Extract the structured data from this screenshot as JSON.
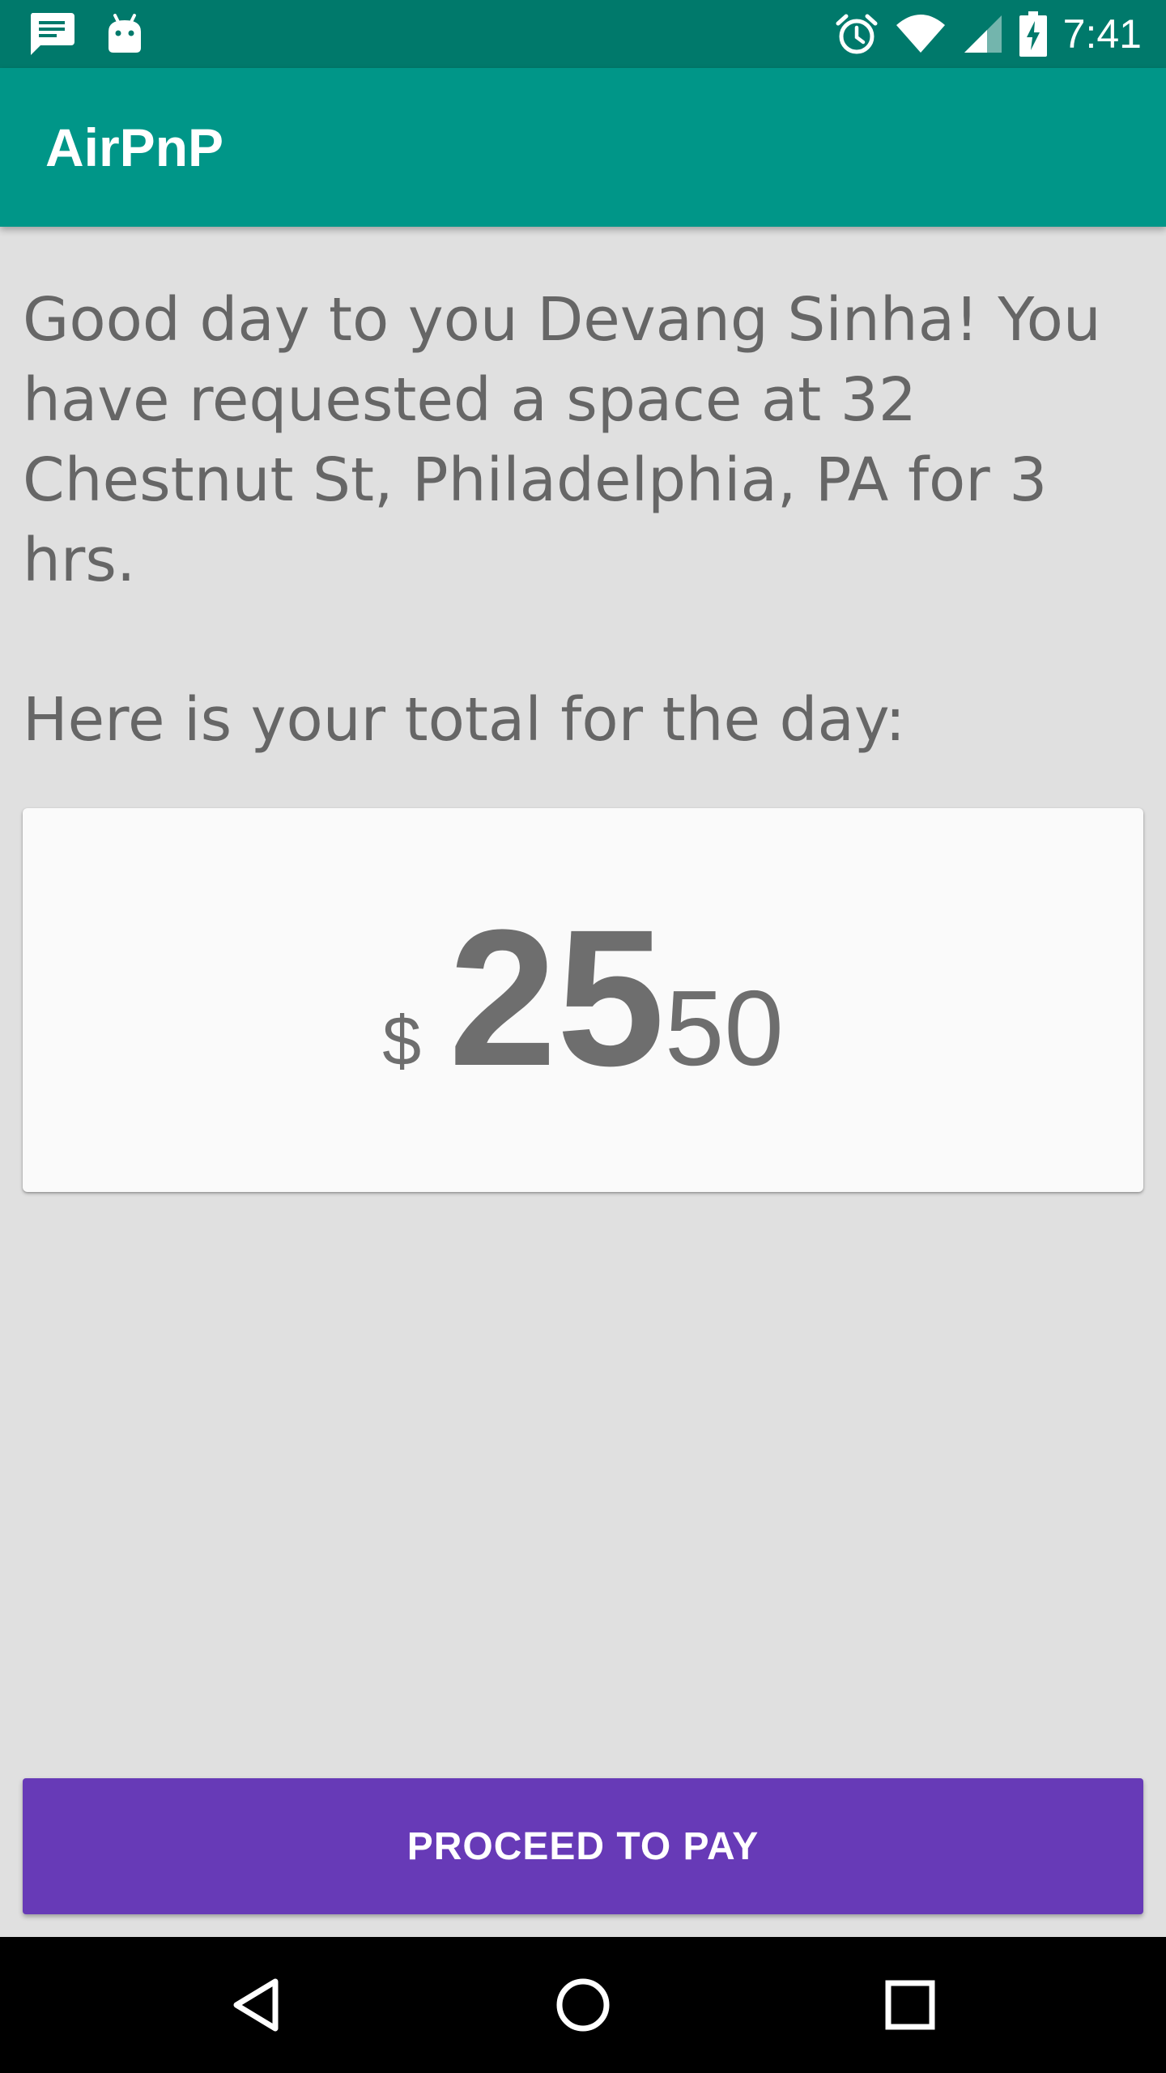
{
  "status_bar": {
    "time": "7:41",
    "left_icons": [
      "message-icon",
      "android-icon"
    ],
    "right_icons": [
      "alarm-icon",
      "wifi-icon",
      "signal-icon",
      "battery-charging-icon"
    ]
  },
  "app_bar": {
    "title": "AirPnP"
  },
  "main": {
    "message": "Good day to you Devang Sinha! You have requested a space at 32 Chestnut St, Philadelphia, PA for 3 hrs.",
    "total_label": "Here is your total for the day:",
    "price": {
      "currency": "$",
      "dollars": "25",
      "cents": "50"
    },
    "pay_button_label": "PROCEED TO PAY"
  },
  "nav_bar": {
    "buttons": [
      "back-icon",
      "home-icon",
      "recents-icon"
    ]
  },
  "colors": {
    "status_bar": "#00796b",
    "app_bar": "#009688",
    "background": "#e0e0e0",
    "card": "#fafafa",
    "text": "#666666",
    "button": "#673ab7",
    "nav_bar": "#000000"
  }
}
